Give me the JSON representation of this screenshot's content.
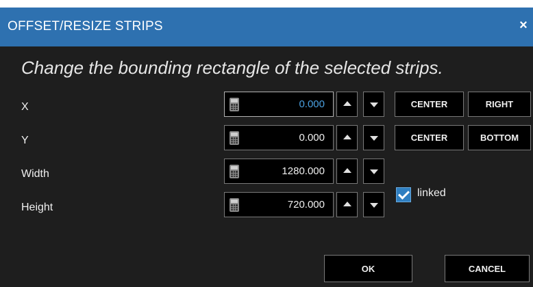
{
  "dialog": {
    "title": "OFFSET/RESIZE STRIPS",
    "close_glyph": "×",
    "description": "Change the bounding rectangle of the selected strips."
  },
  "fields": {
    "x": {
      "label": "X",
      "value": "0.000",
      "btn1": "CENTER",
      "btn2": "RIGHT"
    },
    "y": {
      "label": "Y",
      "value": "0.000",
      "btn1": "CENTER",
      "btn2": "BOTTOM"
    },
    "width": {
      "label": "Width",
      "value": "1280.000"
    },
    "height": {
      "label": "Height",
      "value": "720.000"
    }
  },
  "linked": {
    "label": "linked",
    "checked": true
  },
  "footer": {
    "ok_label": "OK",
    "cancel_label": "CANCEL"
  },
  "colors": {
    "titlebar": "#2e71b0",
    "background": "#1e1e1e",
    "accent": "#2f7fc1"
  },
  "icons": [
    "close-icon",
    "calculator-icon",
    "arrow-up-icon",
    "arrow-down-icon",
    "checkmark-icon"
  ]
}
